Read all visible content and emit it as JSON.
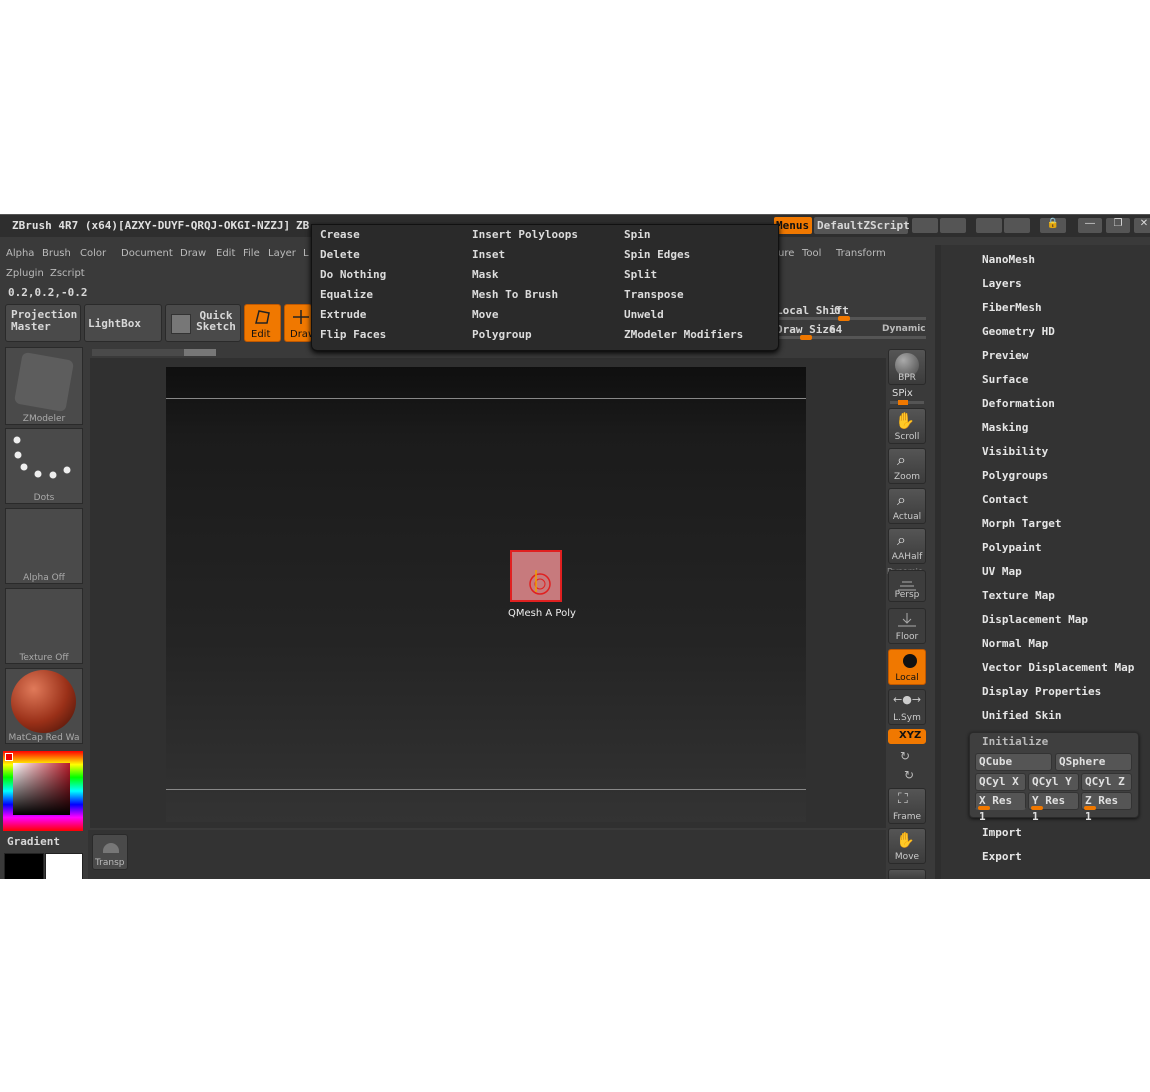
{
  "titlebar": {
    "title": "ZBrush 4R7 (x64)[AZXY-DUYF-QRQJ-OKGI-NZZJ]",
    "title_suffix": "ZB",
    "menus_label": "Menus",
    "script_label": "DefaultZScript"
  },
  "menubar": {
    "items": [
      "Alpha",
      "Brush",
      "Color",
      "Document",
      "Draw",
      "Edit",
      "File",
      "Layer",
      "L"
    ],
    "right_items": [
      "ure",
      "Tool",
      "Transform"
    ],
    "row2": [
      "Zplugin",
      "Zscript"
    ]
  },
  "coords": "0.2,0.2,-0.2",
  "shelf": {
    "projection_master": "Projection Master",
    "lightbox": "LightBox",
    "quick_sketch": "Quick Sketch",
    "edit": "Edit",
    "draw": "Draw",
    "local_shift_label": "Local Shift",
    "local_shift_prefix": "L",
    "local_shift_value": "0",
    "draw_size_label": "Draw Size",
    "draw_size_prefix": "D",
    "draw_size_value": "64",
    "dynamic_label": "Dynamic"
  },
  "left_tray": {
    "brush_label": "ZModeler",
    "stroke_label": "Dots",
    "alpha_label": "Alpha  Off",
    "texture_label": "Texture  Off",
    "material_label": "MatCap  Red  Wa",
    "gradient_label": "Gradient"
  },
  "canvas": {
    "poly_label": "QMesh  A  Poly",
    "transp_label": "Transp"
  },
  "right_toolbar": {
    "bpr": "BPR",
    "spix": "SPix",
    "scroll": "Scroll",
    "zoom": "Zoom",
    "actual": "Actual",
    "aahalf": "AAHalf",
    "dynamic": "Dynamic",
    "persp": "Persp",
    "floor": "Floor",
    "local": "Local",
    "lsym": "L.Sym",
    "xyz": "XYZ",
    "frame": "Frame",
    "move": "Move"
  },
  "popup": {
    "col1": [
      "Crease",
      "Delete",
      "Do Nothing",
      "Equalize",
      "Extrude",
      "Flip Faces"
    ],
    "col2": [
      "Insert Polyloops",
      "Inset",
      "Mask",
      "Mesh To Brush",
      "Move",
      "Polygroup"
    ],
    "col3": [
      "Spin",
      "Spin Edges",
      "Split",
      "Transpose",
      "Unweld",
      "ZModeler Modifiers"
    ]
  },
  "tool_panel": {
    "items": [
      "NanoMesh",
      "Layers",
      "FiberMesh",
      "Geometry HD",
      "Preview",
      "Surface",
      "Deformation",
      "Masking",
      "Visibility",
      "Polygroups",
      "Contact",
      "Morph Target",
      "Polypaint",
      "UV Map",
      "Texture Map",
      "Displacement Map",
      "Normal Map",
      "Vector Displacement Map",
      "Display Properties",
      "Unified Skin"
    ],
    "initialize": {
      "title": "Initialize",
      "qcube": "QCube",
      "qsphere": "QSphere",
      "qcylx": "QCyl X",
      "qcyly": "QCyl Y",
      "qcylz": "QCyl Z",
      "xres": "X Res 1",
      "yres": "Y Res 1",
      "zres": "Z Res 1"
    },
    "bottom_items": [
      "Import",
      "Export"
    ]
  },
  "colors": {
    "accent": "#f07800",
    "background": "#3a3a3a",
    "canvas": "#1e1e1e"
  }
}
